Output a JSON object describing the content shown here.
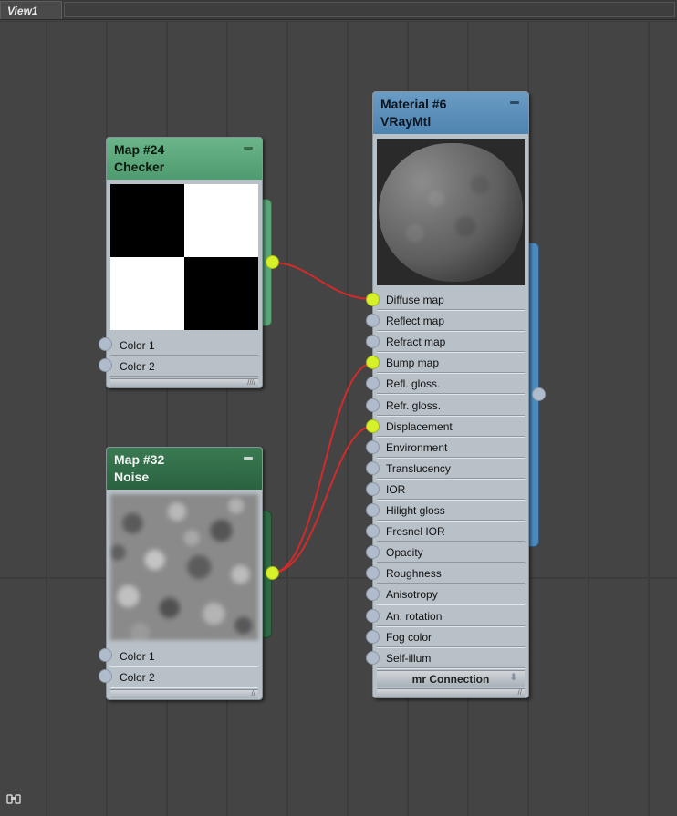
{
  "tab": {
    "label": "View1"
  },
  "colors": {
    "canvas_bg": "#444444",
    "checker_header": "#5aa57a",
    "noise_header": "#2e6b45",
    "material_header": "#5a8fb8",
    "node_body": "#b8c0c8",
    "socket_active": "#d6f02a",
    "socket_idle": "#b0bccb",
    "wire": "#d42a2a"
  },
  "nodes": {
    "checker": {
      "title": "Map #24",
      "type": "Checker",
      "params": [
        "Color 1",
        "Color 2"
      ]
    },
    "noise": {
      "title": "Map #32",
      "type": "Noise",
      "params": [
        "Color 1",
        "Color 2"
      ]
    },
    "material": {
      "title": "Material #6",
      "type": "VRayMtl",
      "params": [
        {
          "label": "Diffuse map",
          "connected": true
        },
        {
          "label": "Reflect map",
          "connected": false
        },
        {
          "label": "Refract map",
          "connected": false
        },
        {
          "label": "Bump map",
          "connected": true
        },
        {
          "label": "Refl. gloss.",
          "connected": false
        },
        {
          "label": "Refr. gloss.",
          "connected": false
        },
        {
          "label": "Displacement",
          "connected": true
        },
        {
          "label": "Environment",
          "connected": false
        },
        {
          "label": "Translucency",
          "connected": false
        },
        {
          "label": "IOR",
          "connected": false
        },
        {
          "label": "Hilight gloss",
          "connected": false
        },
        {
          "label": "Fresnel IOR",
          "connected": false
        },
        {
          "label": "Opacity",
          "connected": false
        },
        {
          "label": "Roughness",
          "connected": false
        },
        {
          "label": "Anisotropy",
          "connected": false
        },
        {
          "label": "An. rotation",
          "connected": false
        },
        {
          "label": "Fog color",
          "connected": false
        },
        {
          "label": "Self-illum",
          "connected": false
        }
      ],
      "rollout": "mr Connection"
    }
  },
  "wires": [
    {
      "from": "Map #24",
      "to": "Diffuse map"
    },
    {
      "from": "Map #32",
      "to": "Bump map"
    },
    {
      "from": "Map #32",
      "to": "Displacement"
    }
  ],
  "icons": {
    "find": "binoculars-icon"
  }
}
